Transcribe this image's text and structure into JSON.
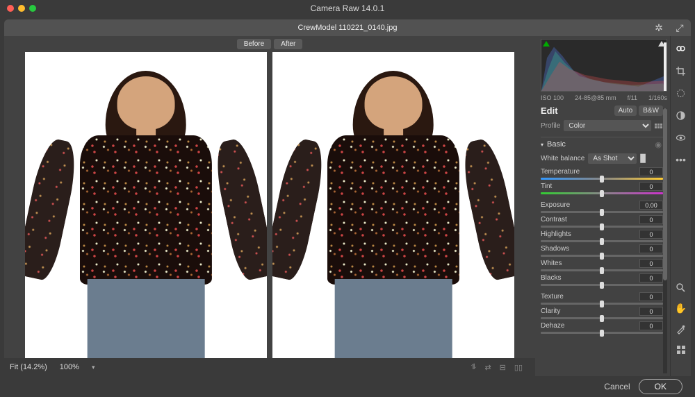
{
  "titlebar": {
    "title": "Camera Raw 14.0.1"
  },
  "filebar": {
    "filename": "CrewModel 110221_0140.jpg"
  },
  "beforeAfter": {
    "before": "Before",
    "after": "After"
  },
  "zoom": {
    "fit": "Fit (14.2%)",
    "pct": "100%"
  },
  "meta": {
    "iso": "ISO 100",
    "lens": "24-85@85 mm",
    "aperture": "f/11",
    "shutter": "1/160s"
  },
  "edit": {
    "title": "Edit",
    "auto": "Auto",
    "bw": "B&W"
  },
  "profile": {
    "label": "Profile",
    "value": "Color"
  },
  "basic": {
    "title": "Basic",
    "wb": {
      "label": "White balance",
      "value": "As Shot"
    },
    "sliders": [
      {
        "label": "Temperature",
        "value": "0",
        "track": "temp"
      },
      {
        "label": "Tint",
        "value": "0",
        "track": "tint"
      }
    ],
    "sliders2": [
      {
        "label": "Exposure",
        "value": "0.00"
      },
      {
        "label": "Contrast",
        "value": "0"
      },
      {
        "label": "Highlights",
        "value": "0"
      },
      {
        "label": "Shadows",
        "value": "0"
      },
      {
        "label": "Whites",
        "value": "0"
      },
      {
        "label": "Blacks",
        "value": "0"
      }
    ],
    "sliders3": [
      {
        "label": "Texture",
        "value": "0"
      },
      {
        "label": "Clarity",
        "value": "0"
      },
      {
        "label": "Dehaze",
        "value": "0"
      }
    ]
  },
  "footer": {
    "cancel": "Cancel",
    "ok": "OK"
  }
}
